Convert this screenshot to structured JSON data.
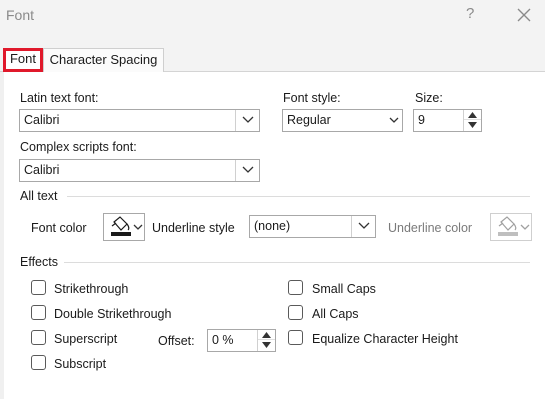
{
  "window": {
    "title": "Font",
    "help_glyph": "?"
  },
  "tabs": [
    {
      "label": "Font",
      "selected": true
    },
    {
      "label": "Character Spacing",
      "selected": false
    }
  ],
  "font": {
    "latin_label": "Latin text font:",
    "latin_value": "Calibri",
    "style_label": "Font style:",
    "style_value": "Regular",
    "size_label": "Size:",
    "size_value": "9",
    "complex_label": "Complex scripts font:",
    "complex_value": "Calibri"
  },
  "all_text": {
    "section_label": "All text",
    "font_color_label": "Font color",
    "underline_style_label": "Underline style",
    "underline_style_value": "(none)",
    "underline_color_label": "Underline color"
  },
  "effects": {
    "section_label": "Effects",
    "strikethrough": "Strikethrough",
    "double_strikethrough": "Double Strikethrough",
    "superscript": "Superscript",
    "subscript": "Subscript",
    "offset_label": "Offset:",
    "offset_value": "0 %",
    "small_caps": "Small Caps",
    "all_caps": "All Caps",
    "equalize": "Equalize Character Height"
  },
  "colors": {
    "selected_tab_outline": "#e0192b",
    "font_color_swatch": "#1a1a1a",
    "underline_color_swatch": "#bfbfbf"
  }
}
